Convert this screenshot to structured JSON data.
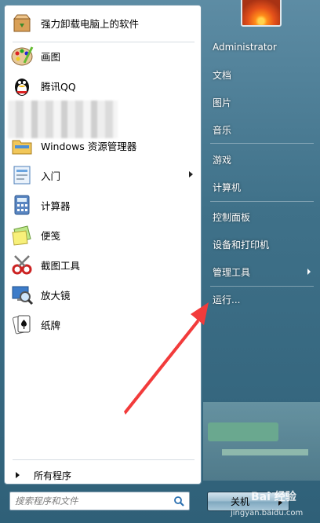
{
  "left_pane": {
    "pinned": [
      {
        "label": "强力卸载电脑上的软件",
        "icon": "uninstall-box-icon"
      }
    ],
    "recent": [
      {
        "label": "画图",
        "icon": "paint-palette-icon"
      },
      {
        "label": "腾讯QQ",
        "icon": "qq-penguin-icon"
      },
      {
        "label": "Windows 资源管理器",
        "icon": "explorer-folder-icon"
      },
      {
        "label": "入门",
        "icon": "getting-started-icon",
        "submenu": true
      },
      {
        "label": "计算器",
        "icon": "calculator-icon"
      },
      {
        "label": "便笺",
        "icon": "sticky-notes-icon"
      },
      {
        "label": "截图工具",
        "icon": "snipping-tool-icon"
      },
      {
        "label": "放大镜",
        "icon": "magnifier-icon"
      },
      {
        "label": "纸牌",
        "icon": "solitaire-cards-icon"
      }
    ],
    "all_programs": "所有程序",
    "search_placeholder": "搜索程序和文件"
  },
  "right_pane": {
    "user_name": "Administrator",
    "items": [
      {
        "label": "文档"
      },
      {
        "label": "图片"
      },
      {
        "label": "音乐"
      },
      {
        "label": "游戏"
      },
      {
        "label": "计算机"
      },
      {
        "label": "控制面板"
      },
      {
        "label": "设备和打印机"
      },
      {
        "label": "管理工具",
        "submenu": true
      },
      {
        "label": "运行..."
      }
    ],
    "shutdown_label": "关机"
  },
  "watermark": {
    "main": "Bai 经验",
    "sub": "jingyan.baidu.com"
  },
  "colors": {
    "annotation_arrow": "#f23b3b",
    "pane_background": "#3f7189"
  }
}
